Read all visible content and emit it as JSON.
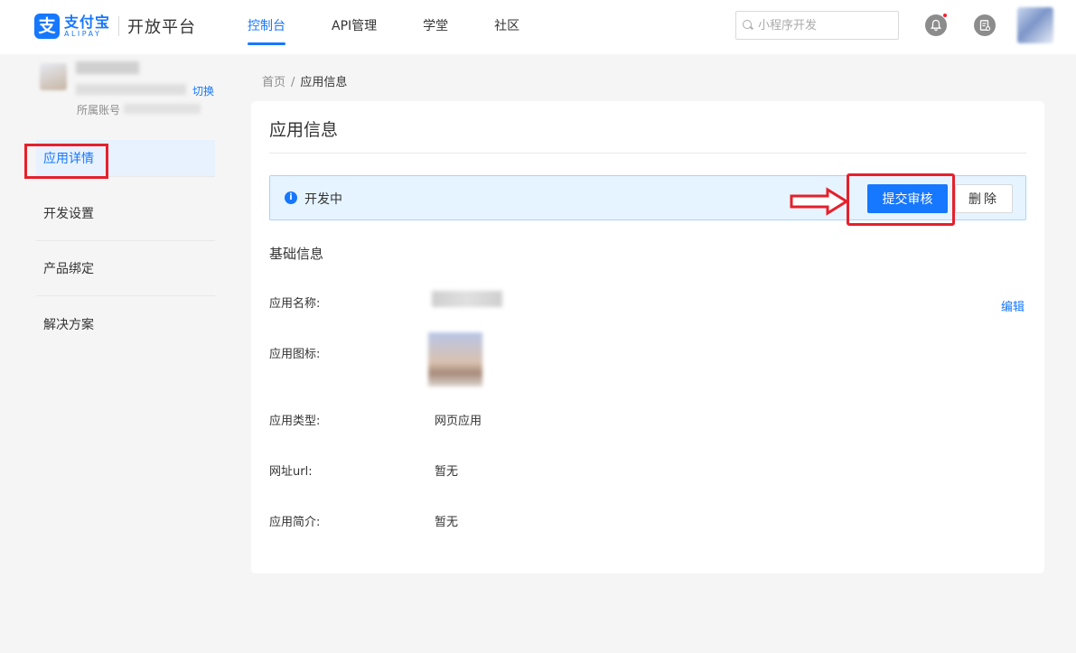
{
  "header": {
    "logo_cn": "支付宝",
    "logo_en": "ALIPAY",
    "logo_symbol": "支",
    "platform_name": "开放平台",
    "nav": [
      {
        "label": "控制台",
        "active": true
      },
      {
        "label": "API管理",
        "active": false
      },
      {
        "label": "学堂",
        "active": false
      },
      {
        "label": "社区",
        "active": false
      }
    ],
    "search_placeholder": "小程序开发",
    "icons": [
      "bell-icon",
      "note-icon",
      "user-avatar"
    ]
  },
  "sidebar": {
    "switch_label": "切换",
    "owner_label": "所属账号",
    "items": [
      {
        "label": "应用详情",
        "active": true
      },
      {
        "label": "开发设置",
        "active": false
      },
      {
        "label": "产品绑定",
        "active": false
      },
      {
        "label": "解决方案",
        "active": false
      }
    ]
  },
  "breadcrumb": {
    "home": "首页",
    "separator": "/",
    "current": "应用信息"
  },
  "main": {
    "title": "应用信息",
    "status": {
      "text": "开发中",
      "info_icon": "i",
      "submit_label": "提交审核",
      "delete_label": "删除"
    },
    "section_title": "基础信息",
    "edit_label": "编辑",
    "fields": {
      "name_label": "应用名称:",
      "icon_label": "应用图标:",
      "type_label": "应用类型:",
      "type_value": "网页应用",
      "url_label": "网址url:",
      "url_value": "暂无",
      "intro_label": "应用简介:",
      "intro_value": "暂无"
    }
  },
  "colors": {
    "brand": "#1677ff",
    "annotation": "#e6202b",
    "status_bg": "#e6f4ff"
  }
}
